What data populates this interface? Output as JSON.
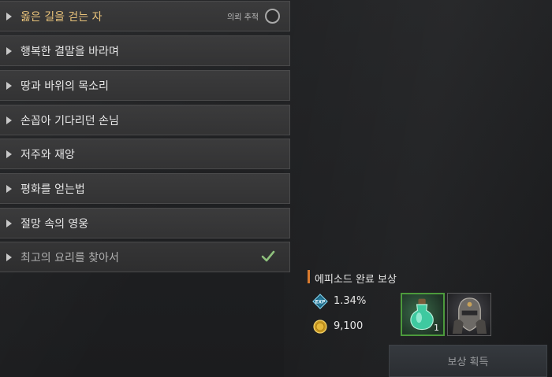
{
  "quests": [
    {
      "title": "옳은 길을 걷는 자",
      "state": "active"
    },
    {
      "title": "행복한 결말을 바라며",
      "state": "normal"
    },
    {
      "title": "땅과 바위의 목소리",
      "state": "normal"
    },
    {
      "title": "손꼽아 기다리던 손님",
      "state": "normal"
    },
    {
      "title": "저주와 재앙",
      "state": "normal"
    },
    {
      "title": "평화를 얻는법",
      "state": "normal"
    },
    {
      "title": "절망 속의 영웅",
      "state": "normal"
    },
    {
      "title": "최고의 요리를 찾아서",
      "state": "completed"
    }
  ],
  "tracking": {
    "label": "의뢰 추적"
  },
  "reward": {
    "title": "에피소드 완료 보상",
    "exp": "1.34%",
    "gold": "9,100",
    "items": [
      {
        "icon": "potion-icon",
        "qty": "1"
      },
      {
        "icon": "armor-icon",
        "qty": ""
      }
    ],
    "claim_label": "보상 획득"
  },
  "colors": {
    "active_title": "#e8c27a",
    "accent": "#d97a2e",
    "check": "#8ec07c",
    "item_border": "#4c9a3c"
  }
}
